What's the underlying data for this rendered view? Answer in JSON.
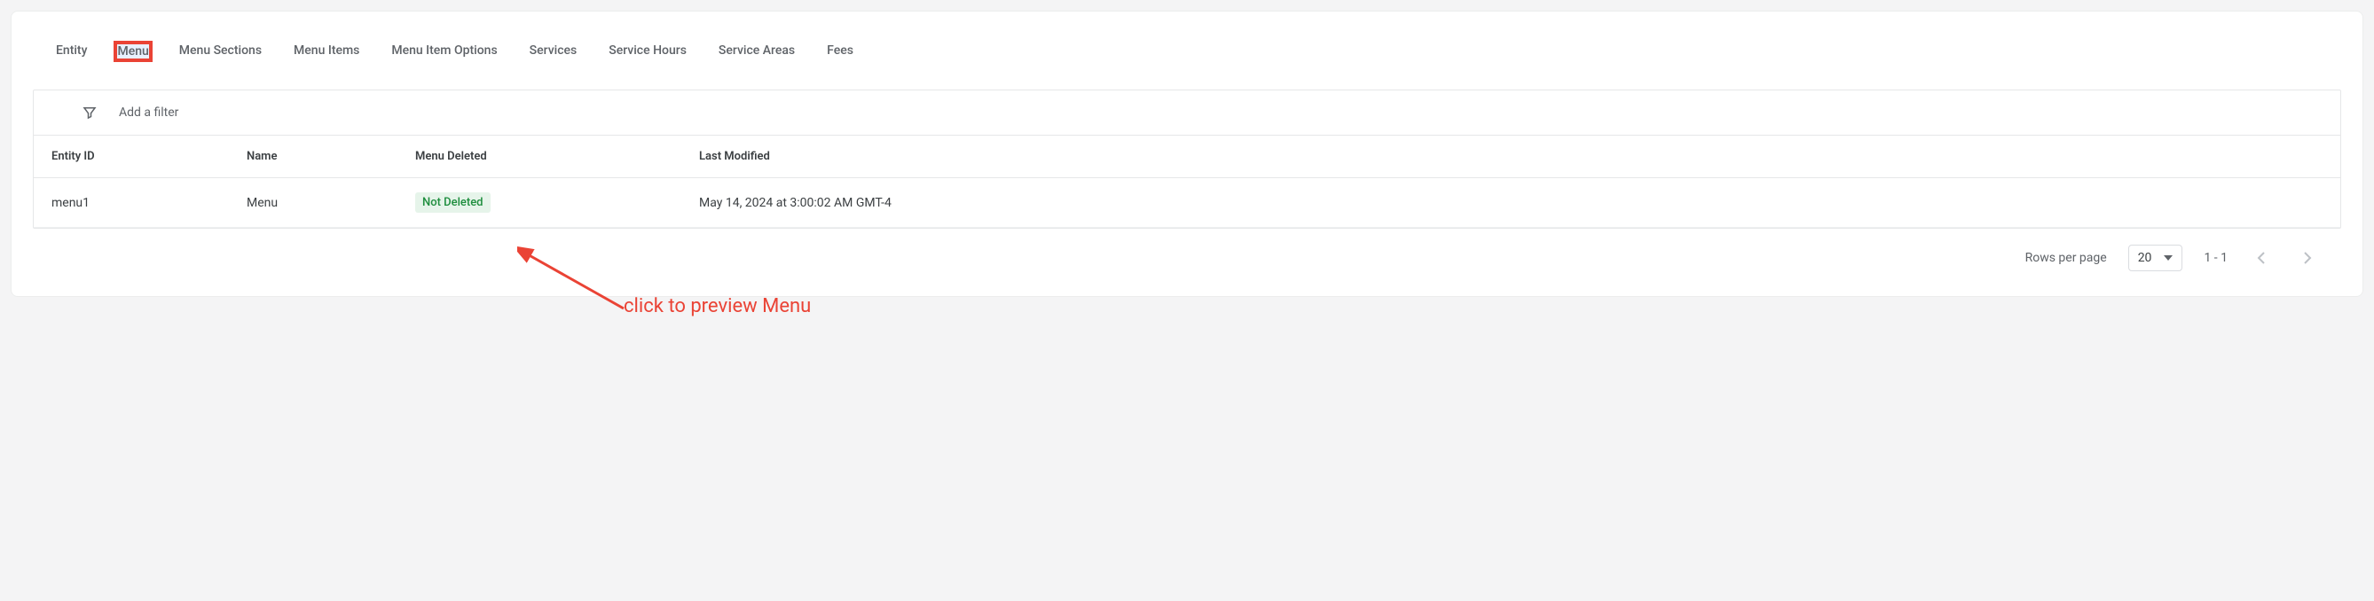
{
  "tabs": {
    "entity": "Entity",
    "menu": "Menu",
    "menu_sections": "Menu Sections",
    "menu_items": "Menu Items",
    "menu_item_options": "Menu Item Options",
    "services": "Services",
    "service_hours": "Service Hours",
    "service_areas": "Service Areas",
    "fees": "Fees",
    "active": "menu"
  },
  "filter": {
    "placeholder": "Add a filter"
  },
  "table": {
    "headers": {
      "entity_id": "Entity ID",
      "name": "Name",
      "menu_deleted": "Menu Deleted",
      "last_modified": "Last Modified"
    },
    "rows": [
      {
        "entity_id": "menu1",
        "name": "Menu",
        "menu_deleted": "Not Deleted",
        "last_modified": "May 14, 2024 at 3:00:02 AM GMT-4"
      }
    ]
  },
  "pagination": {
    "rows_per_page_label": "Rows per page",
    "rows_per_page_value": "20",
    "range": "1 - 1"
  },
  "annotation": {
    "text": "click to preview Menu"
  }
}
